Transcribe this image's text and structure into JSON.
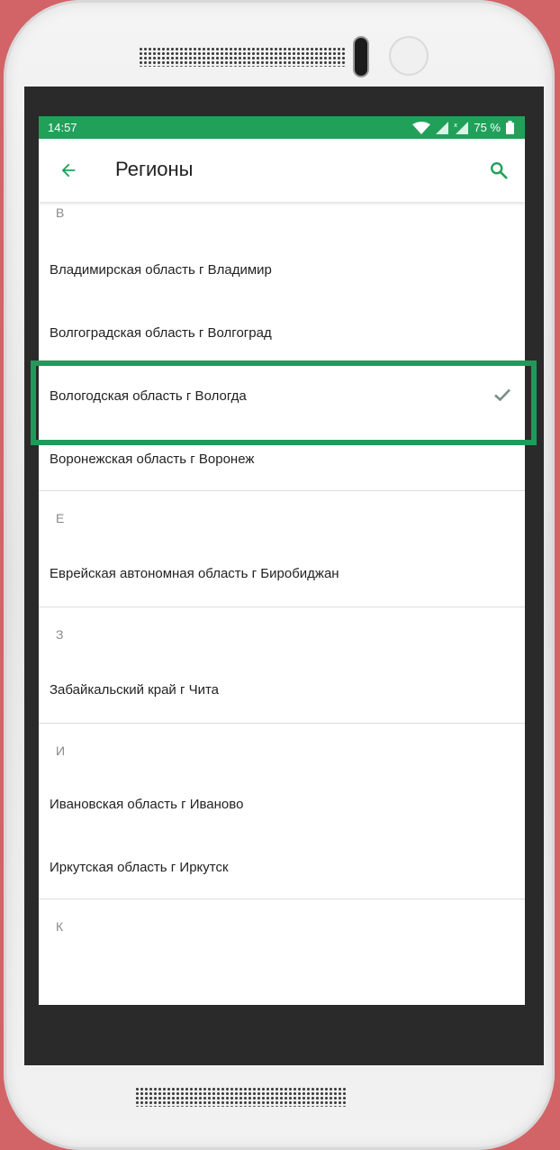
{
  "status": {
    "time": "14:57",
    "battery": "75 %"
  },
  "appbar": {
    "title": "Регионы"
  },
  "sections": [
    {
      "letter": "В",
      "items": [
        "Владимирская область г Владимир",
        "Волгоградская область г Волгоград",
        "Вологодская область г Вологда",
        "Воронежская область г Воронеж"
      ]
    },
    {
      "letter": "Е",
      "items": [
        "Еврейская автономная область г Биробиджан"
      ]
    },
    {
      "letter": "З",
      "items": [
        "Забайкальский край г Чита"
      ]
    },
    {
      "letter": "И",
      "items": [
        "Ивановская область г Иваново",
        "Иркутская область г Иркутск"
      ]
    },
    {
      "letter": "К",
      "items": []
    }
  ],
  "selected_item": "Вологодская область г Вологда",
  "colors": {
    "accent": "#21a05a",
    "highlight": "#1e9a5a",
    "background": "#d26468"
  }
}
